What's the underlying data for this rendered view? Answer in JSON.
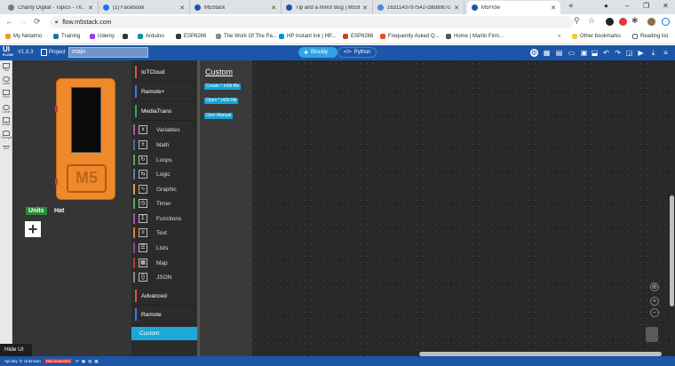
{
  "browser": {
    "tabs": [
      {
        "title": "Charity Digital - Topics - Th..",
        "icon": "charity-favicon",
        "color": "#7a7a7a",
        "active": false
      },
      {
        "title": "(1) Facebook",
        "icon": "facebook-favicon",
        "color": "#1877f2",
        "active": false
      },
      {
        "title": "M5Stack",
        "icon": "m5stack-favicon",
        "color": "#1b56a8",
        "active": false
      },
      {
        "title": "Tip and a minor Bug | M5St..",
        "icon": "m5stack-favicon",
        "color": "#1b56a8",
        "active": false
      },
      {
        "title": "1631143797542-c8bb067c-..",
        "icon": "image-favicon",
        "color": "#4a8ad4",
        "active": false
      },
      {
        "title": "M5Flow",
        "icon": "m5flow-favicon",
        "color": "#1b56a8",
        "active": true
      }
    ],
    "url": "flow.m5stack.com",
    "bookmarks": [
      {
        "label": "My Netatmo",
        "icon": "netatmo-icon",
        "color": "#e8a020"
      },
      {
        "label": "Training",
        "icon": "wordpress-icon",
        "color": "#21759b"
      },
      {
        "label": "Udemy",
        "icon": "udemy-icon",
        "color": "#a435f0"
      },
      {
        "label": "",
        "icon": "bookmark-icon",
        "color": "#333333"
      },
      {
        "label": "Arduino",
        "icon": "arduino-icon",
        "color": "#00979d"
      },
      {
        "label": "ESP8266",
        "icon": "esp-icon",
        "color": "#333333"
      },
      {
        "label": "The Work Of The Pa...",
        "icon": "doc-icon",
        "color": "#888888"
      },
      {
        "label": "HP Instant Ink | HP...",
        "icon": "hp-icon",
        "color": "#0096d6"
      },
      {
        "label": "ESP8266",
        "icon": "esp-icon",
        "color": "#d04020"
      },
      {
        "label": "Frequently Asked Q...",
        "icon": "faq-icon",
        "color": "#e05020"
      },
      {
        "label": "Home | Marlin Firm...",
        "icon": "home-icon",
        "color": "#555555"
      }
    ],
    "other_bookmarks": "Other bookmarks",
    "reading_list": "Reading list"
  },
  "app": {
    "logo": "UI",
    "logo_sub": "FLOW",
    "version": "V1.8.3",
    "project_label": "Project",
    "project_name": "main",
    "blockly_label": "Blockly",
    "python_label": "Python"
  },
  "rail": [
    {
      "label": "Title",
      "icon": "title-icon"
    },
    {
      "label": "Label",
      "icon": "label-icon"
    },
    {
      "label": "Rect",
      "icon": "rect-icon"
    },
    {
      "label": "Circle",
      "icon": "circle-icon"
    },
    {
      "label": "Image",
      "icon": "image-icon"
    },
    {
      "label": "Triangle",
      "icon": "triangle-icon"
    },
    {
      "label": "Line",
      "icon": "line-icon"
    }
  ],
  "device": {
    "brand": "M5",
    "units_tab": "Units",
    "hat_tab": "Hat"
  },
  "categories": {
    "headers": [
      {
        "label": "IoTCloud",
        "color": "#e74c3c"
      },
      {
        "label": "Remote+",
        "color": "#2f80ed"
      },
      {
        "label": "MediaTrans",
        "color": "#27ae60"
      }
    ],
    "items": [
      {
        "label": "Variables",
        "color": "#a55b9f",
        "icon": "variables-icon"
      },
      {
        "label": "Math",
        "color": "#5b67a5",
        "icon": "math-icon"
      },
      {
        "label": "Loops",
        "color": "#5ba55b",
        "icon": "loops-icon"
      },
      {
        "label": "Logic",
        "color": "#5b80a5",
        "icon": "logic-icon"
      },
      {
        "label": "Graphic",
        "color": "#e0a030",
        "icon": "graphic-icon"
      },
      {
        "label": "Timer",
        "color": "#4caf50",
        "icon": "timer-icon"
      },
      {
        "label": "Functions",
        "color": "#9b59b6",
        "icon": "functions-icon"
      },
      {
        "label": "Text",
        "color": "#e67e22",
        "icon": "text-icon"
      },
      {
        "label": "Lists",
        "color": "#8e44ad",
        "icon": "lists-icon"
      },
      {
        "label": "Map",
        "color": "#c0392b",
        "icon": "map-icon"
      },
      {
        "label": "JSON",
        "color": "#7f8c8d",
        "icon": "json-icon"
      }
    ],
    "advanced": {
      "label": "Advanced",
      "color": "#e74c3c"
    },
    "remote": {
      "label": "Remote",
      "color": "#2f80ed"
    },
    "custom": "Custom"
  },
  "flyout": {
    "title": "Custom",
    "buttons": [
      "Create *.m5b file",
      "Open *.m5b file",
      "User Manual"
    ]
  },
  "footer": {
    "hide_ui": "Hide UI",
    "api_key": "Api key",
    "key_value": "Unknown",
    "status": "Disconnected"
  }
}
